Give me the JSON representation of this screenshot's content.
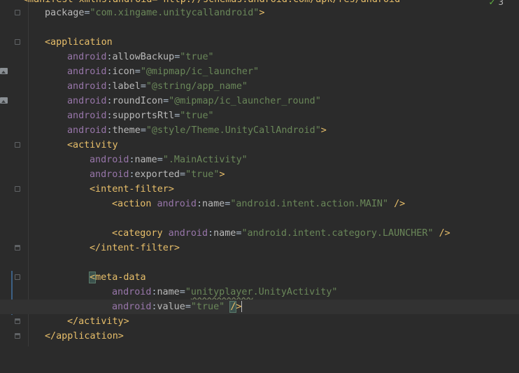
{
  "inspections": {
    "count": "3",
    "icon": "check-icon"
  },
  "editor": {
    "line_manifest": "<manifest xmlns:android=\"http://schemas.android.com/apk/res/android\"",
    "line_package": {
      "attr": "package",
      "eq": "=",
      "val": "\"com.xingame.unitycallandroid\"",
      "close": ">"
    },
    "line_application_open": "<application",
    "attr_allowBackup": {
      "ns": "android",
      "colon": ":",
      "name": "allowBackup",
      "eq": "=",
      "val": "\"true\""
    },
    "attr_icon": {
      "ns": "android",
      "colon": ":",
      "name": "icon",
      "eq": "=",
      "val": "\"@mipmap/ic_launcher\""
    },
    "attr_label": {
      "ns": "android",
      "colon": ":",
      "name": "label",
      "eq": "=",
      "val": "\"@string/app_name\""
    },
    "attr_roundIcon": {
      "ns": "android",
      "colon": ":",
      "name": "roundIcon",
      "eq": "=",
      "val": "\"@mipmap/ic_launcher_round\""
    },
    "attr_supportsRtl": {
      "ns": "android",
      "colon": ":",
      "name": "supportsRtl",
      "eq": "=",
      "val": "\"true\""
    },
    "attr_theme": {
      "ns": "android",
      "colon": ":",
      "name": "theme",
      "eq": "=",
      "val": "\"@style/Theme.UnityCallAndroid\"",
      "close": ">"
    },
    "line_activity_open": "<activity",
    "attr_act_name": {
      "ns": "android",
      "colon": ":",
      "name": "name",
      "eq": "=",
      "val": "\".MainActivity\""
    },
    "attr_act_exported": {
      "ns": "android",
      "colon": ":",
      "name": "exported",
      "eq": "=",
      "val": "\"true\"",
      "close": ">"
    },
    "line_intent_filter_open": "<intent-filter>",
    "line_action": {
      "tag": "<action",
      "ns": "android",
      "colon": ":",
      "name": "name",
      "eq": "=",
      "val": "\"android.intent.action.MAIN\"",
      "close": " />"
    },
    "line_category": {
      "tag": "<category",
      "ns": "android",
      "colon": ":",
      "name": "name",
      "eq": "=",
      "val": "\"android.intent.category.LAUNCHER\"",
      "close": " />"
    },
    "line_intent_filter_close": "</intent-filter>",
    "line_meta_lt": "<",
    "line_meta_open": "meta-data",
    "attr_meta_name": {
      "ns": "android",
      "colon": ":",
      "name": "name",
      "eq": "=",
      "q1": "\"",
      "val_wavy": "unityplayer",
      "val_rest": ".UnityActivity\""
    },
    "attr_meta_value": {
      "ns": "android",
      "colon": ":",
      "name": "value",
      "eq": "=",
      "val": "\"true\"",
      "close_slash": "/",
      "close_gt": ">"
    },
    "line_activity_close": "</activity>",
    "line_application_close": "</application>"
  },
  "colors": {
    "background": "#2b2b2b",
    "tag": "#e8bf6a",
    "namespace": "#9876aa",
    "attribute": "#bababa",
    "value": "#6a8759"
  }
}
